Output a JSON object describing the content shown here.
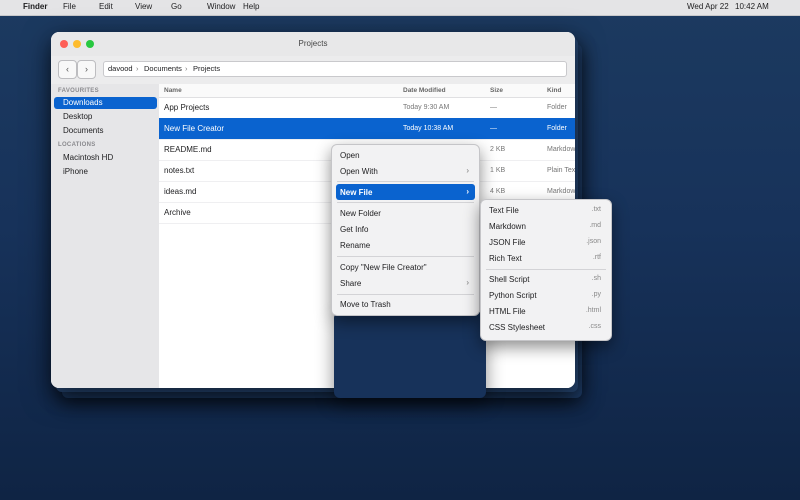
{
  "menubar": {
    "apple": "",
    "app": "Finder",
    "items": [
      "File",
      "Edit",
      "View",
      "Go",
      "Window",
      "Help"
    ],
    "date": "Wed Apr 22",
    "time": "10:42 AM"
  },
  "window": {
    "title": "Projects",
    "nav_back": "‹",
    "nav_forward": "›",
    "path": [
      "davood",
      "Documents",
      "Projects"
    ],
    "path_sep": "›"
  },
  "sidebar": {
    "favourites_head": "FAVOURITES",
    "favourites": [
      "Downloads",
      "Desktop",
      "Documents"
    ],
    "locations_head": "LOCATIONS",
    "locations": [
      "Macintosh HD",
      "iPhone"
    ]
  },
  "columns": {
    "name": "Name",
    "date": "Date Modified",
    "size": "Size",
    "kind": "Kind"
  },
  "rows": [
    {
      "name": " App Projects",
      "date": "Today 9:30 AM",
      "size": "—",
      "kind": "Folder"
    },
    {
      "name": " New File Creator",
      "date": "Today 10:38 AM",
      "size": "—",
      "kind": "Folder"
    },
    {
      "name": " README.md",
      "date": "",
      "size": "2 KB",
      "kind": "Markdown"
    },
    {
      "name": " notes.txt",
      "date": "",
      "size": "1 KB",
      "kind": "Plain Text"
    },
    {
      "name": " ideas.md",
      "date": "",
      "size": "4 KB",
      "kind": "Markdown"
    },
    {
      "name": " Archive",
      "date": "",
      "size": "",
      "kind": ""
    }
  ],
  "context_menu": {
    "open": "Open",
    "open_with": "Open With",
    "new_file": "New File",
    "new_folder": "New Folder",
    "get_info": "Get Info",
    "rename": "Rename",
    "copy": "Copy \"New File Creator\"",
    "share": "Share",
    "trash": "Move to Trash",
    "arrow": "›"
  },
  "submenu": [
    {
      "label": "Text File",
      "ext": ".txt"
    },
    {
      "label": "Markdown",
      "ext": ".md"
    },
    {
      "label": "JSON File",
      "ext": ".json"
    },
    {
      "label": "Rich Text",
      "ext": ".rtf"
    },
    {
      "label": "Shell Script",
      "ext": ".sh"
    },
    {
      "label": "Python Script",
      "ext": ".py"
    },
    {
      "label": "HTML File",
      "ext": ".html"
    },
    {
      "label": "CSS Stylesheet",
      "ext": ".css"
    }
  ],
  "colors": {
    "accent": "#0a63cf",
    "close": "#fe5f57",
    "minimize": "#febc2e",
    "zoom": "#28c840"
  }
}
